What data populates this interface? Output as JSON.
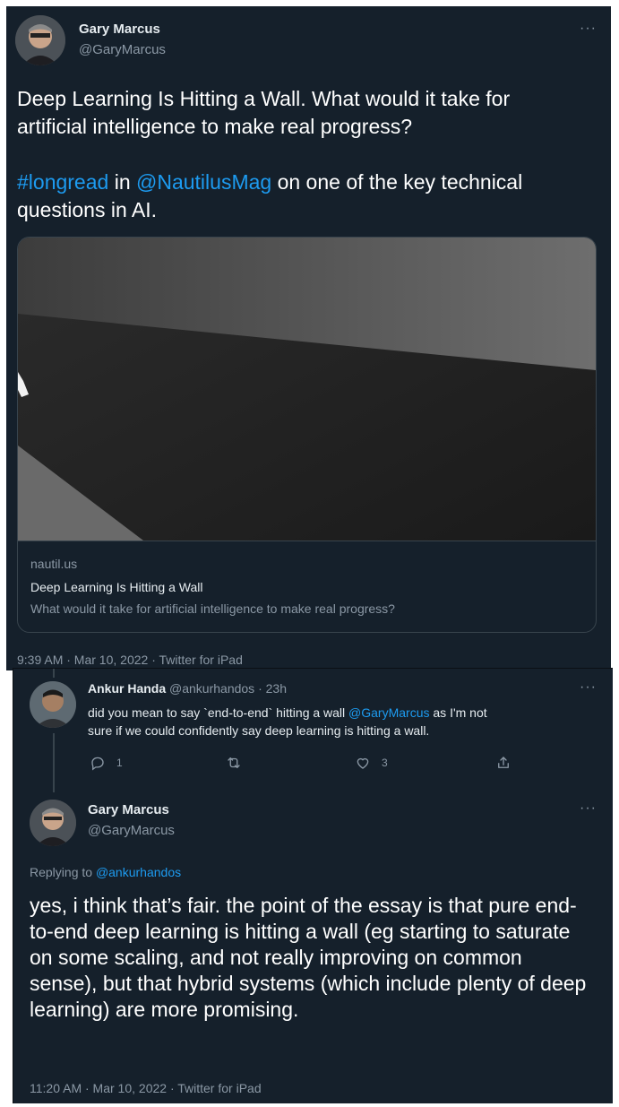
{
  "main_tweet": {
    "author_name": "Gary Marcus",
    "author_handle": "@GaryMarcus",
    "more_label": "···",
    "text_line1": "Deep Learning Is Hitting a Wall. What would it take for",
    "text_line2": "artificial intelligence to make real progress?",
    "hashtag": "#longread",
    "in_word": " in ",
    "mention": "@NautilusMag",
    "text_tail": " on one of the key technical",
    "text_line4": "questions in AI.",
    "card": {
      "domain": "nautil.us",
      "title": "Deep Learning Is Hitting a Wall",
      "description": "What would it take for artificial intelligence to make real progress?"
    },
    "timestamp": "9:39 AM · Mar 10, 2022 · Twitter for iPad"
  },
  "reply": {
    "author_name": "Ankur Handa",
    "author_handle": "@ankurhandos",
    "time": "23h",
    "more_label": "···",
    "text_part1": "did you mean to say `end-to-end` hitting a wall ",
    "mention": "@GaryMarcus",
    "text_part2": " as I'm not",
    "text_line2": "sure if we could confidently say deep learning is hitting a wall.",
    "reply_count": "1",
    "like_count": "3"
  },
  "response": {
    "author_name": "Gary Marcus",
    "author_handle": "@GaryMarcus",
    "more_label": "···",
    "replying_to_label": "Replying to ",
    "replying_to_handle": "@ankurhandos",
    "text": "yes, i think that’s fair. the point of the essay is that pure end-to-end deep learning is hitting a wall (eg starting to saturate on some scaling, and not really improving on common sense), but that hybrid systems (which include plenty of deep learning) are more promising.",
    "timestamp": "11:20 AM · Mar 10, 2022 · Twitter for iPad"
  },
  "colors": {
    "background": "#15202b",
    "link": "#1d9bf0",
    "muted": "#8b98a5",
    "text": "#ffffff"
  }
}
